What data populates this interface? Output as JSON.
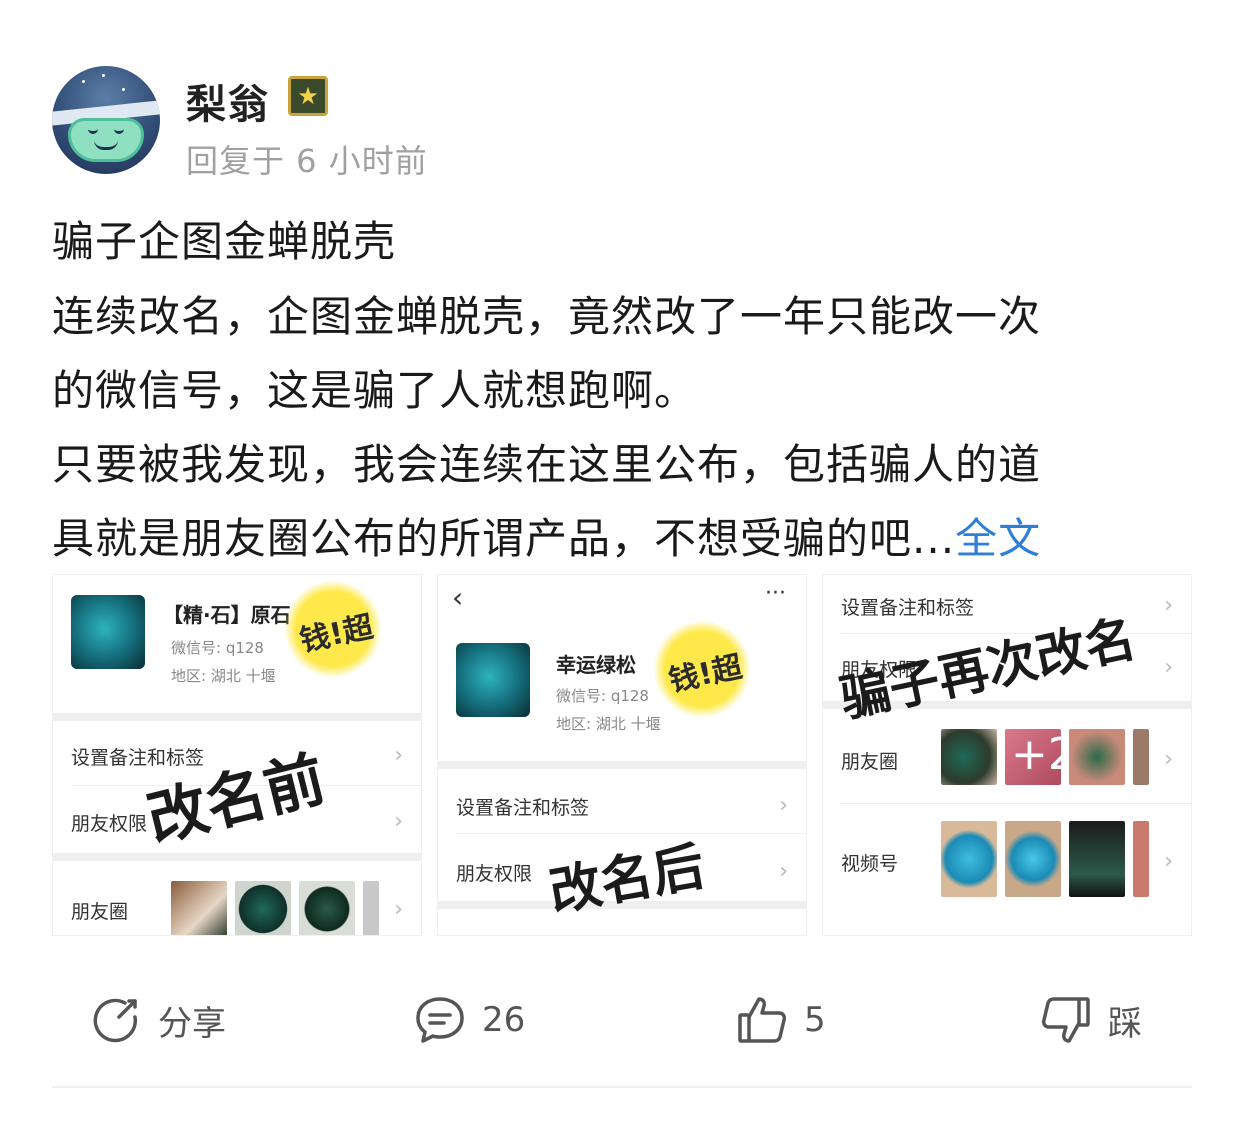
{
  "author": {
    "name": "梨翁",
    "badge_icon": "star-badge-icon",
    "meta": "回复于 6 小时前"
  },
  "post": {
    "title": "骗子企图金蝉脱壳",
    "lines": [
      "连续改名，企图金蝉脱壳，竟然改了一年只能改一次",
      "的微信号，这是骗了人就想跑啊。",
      "只要被我发现，我会连续在这里公布，包括骗人的道",
      "具就是朋友圈公布的所谓产品，不想受骗的吧..."
    ],
    "more_label": "全文"
  },
  "gallery": {
    "shot1": {
      "name": "【精·石】原石",
      "wechat": "微信号: q128",
      "region": "地区: 湖北 十堰",
      "sticker": "钱!超",
      "row1": "设置备注和标签",
      "row2": "朋友权限",
      "row3": "朋友圈",
      "chev": "›",
      "caption": "改名前"
    },
    "shot2": {
      "back": "‹",
      "menu": "···",
      "name": "幸运绿松",
      "wechat": "微信号: q128",
      "region": "地区: 湖北 十堰",
      "sticker": "钱!超",
      "row1": "设置备注和标签",
      "row2": "朋友权限",
      "chev": "›",
      "caption": "改名后"
    },
    "shot3": {
      "row1": "设置备注和标签",
      "row2": "朋友权限",
      "row3": "朋友圈",
      "row4": "视频号",
      "plus_count": "+2",
      "chev": "›",
      "caption": "骗子再次改名"
    }
  },
  "actions": {
    "share": "分享",
    "comments": "26",
    "likes": "5",
    "dislike": "踩"
  },
  "colors": {
    "link": "#2f7fd8",
    "meta": "#a0a0a0",
    "text": "#1a1a1a"
  }
}
